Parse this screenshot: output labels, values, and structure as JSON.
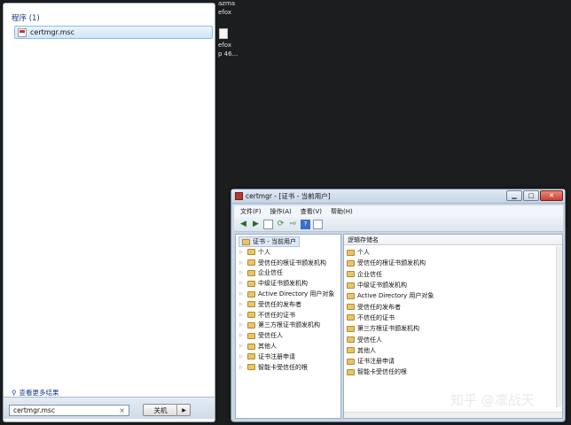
{
  "desktop": {
    "icon1_label_a": "azma",
    "icon1_label_b": "efox",
    "icon2_label_a": "efox",
    "icon2_label_b": "p 46..."
  },
  "start_menu": {
    "section_title": "程序 (1)",
    "result_label": "certmgr.msc",
    "see_more": "查看更多结果",
    "search_value": "certmgr.msc",
    "search_clear": "×",
    "shutdown_label": "关机",
    "shutdown_arrow": "▶"
  },
  "window": {
    "title": "certmgr - [证书 - 当前用户]",
    "buttons": {
      "minimize": "▁",
      "maximize": "□",
      "close": "✕"
    },
    "menu": [
      "文件(F)",
      "操作(A)",
      "查看(V)",
      "帮助(H)"
    ],
    "toolbar": [
      {
        "icon": "back-arrow-icon",
        "glyph": "◀"
      },
      {
        "icon": "forward-arrow-icon",
        "glyph": "▶"
      },
      {
        "icon": "console-tree-icon",
        "glyph": ""
      },
      {
        "icon": "refresh-icon",
        "glyph": "⟳"
      },
      {
        "icon": "export-list-icon",
        "glyph": "⇨"
      },
      {
        "icon": "help-icon",
        "glyph": "?"
      },
      {
        "icon": "properties-icon",
        "glyph": ""
      }
    ],
    "tree_root": "证书 - 当前用户",
    "tree_items": [
      "个人",
      "受信任的根证书颁发机构",
      "企业信任",
      "中级证书颁发机构",
      "Active Directory 用户对象",
      "受信任的发布者",
      "不信任的证书",
      "第三方根证书颁发机构",
      "受信任人",
      "其他人",
      "证书注册申请",
      "智能卡受信任的根"
    ],
    "column_header": "逻辑存储名",
    "list_items": [
      "个人",
      "受信任的根证书颁发机构",
      "企业信任",
      "中级证书颁发机构",
      "Active Directory 用户对象",
      "受信任的发布者",
      "不信任的证书",
      "第三方根证书颁发机构",
      "受信任人",
      "其他人",
      "证书注册申请",
      "智能卡受信任的根"
    ]
  },
  "watermark": "知乎 @凛战天",
  "colors": {
    "desktop_bg": "#1c1d1e",
    "link_blue": "#1e3a8a",
    "folder": "#e9c46a"
  }
}
